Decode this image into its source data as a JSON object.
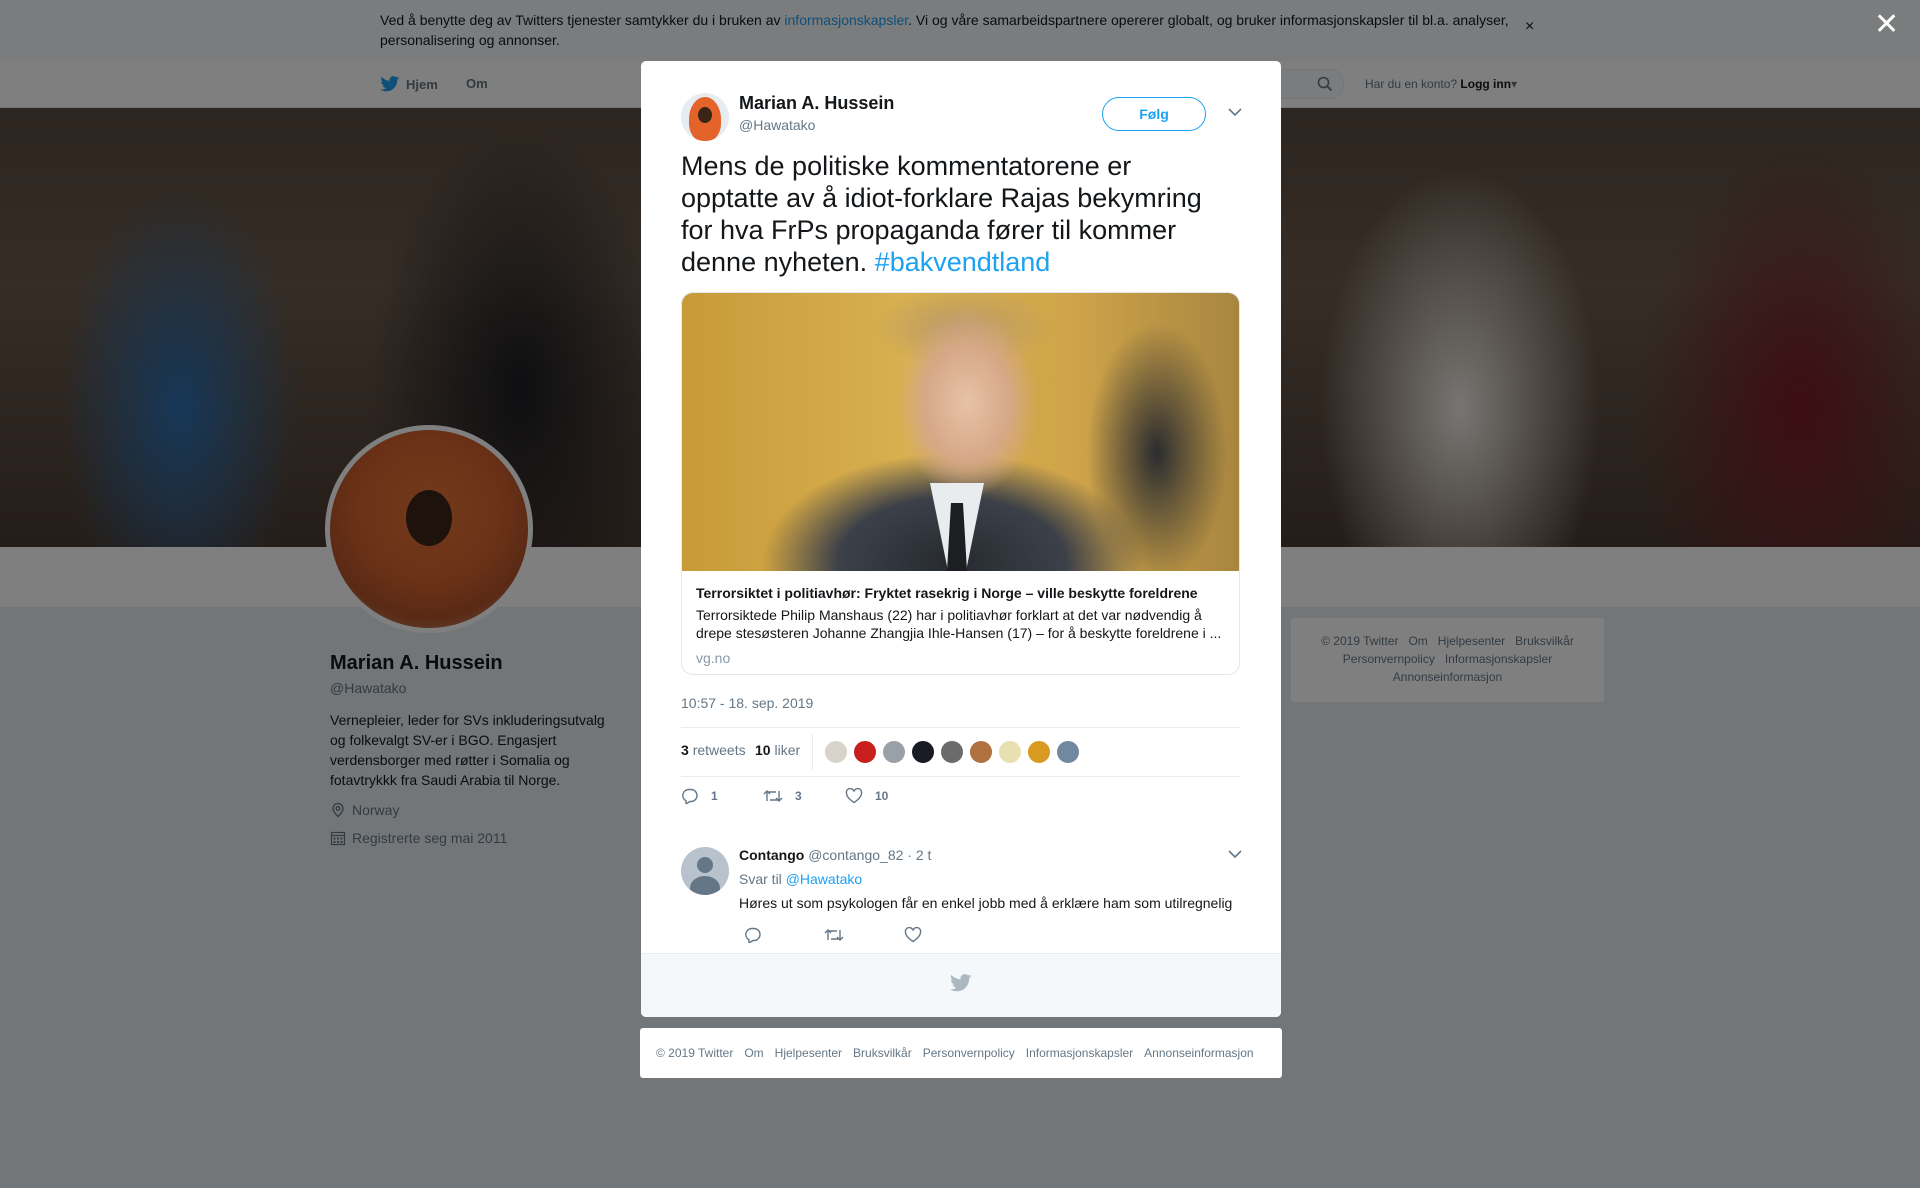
{
  "cookie_notice": {
    "text_before": "Ved å benytte deg av Twitters tjenester samtykker du i bruken av ",
    "link": "informasjonskapsler",
    "text_after": ". Vi og våre samarbeidspartnere opererer globalt, og bruker informasjonskapsler til bl.a. analyser, personalisering og annonser.",
    "close": "×"
  },
  "nav": {
    "home": "Hjem",
    "about": "Om",
    "account_prompt": "Har du en konto?",
    "login": "Logg inn"
  },
  "profile": {
    "name": "Marian A. Hussein",
    "handle": "@Hawatako",
    "bio": "Vernepleier, leder for SVs inkluderingsutvalg og folkevalgt SV-er i BGO. Engasjert verdensborger med røtter i Somalia og fotavtrykkk fra Saudi Arabia til Norge.",
    "location": "Norway",
    "joined": "Registrerte seg mai 2011"
  },
  "side_footer": {
    "links": [
      "© 2019 Twitter",
      "Om",
      "Hjelpesenter",
      "Bruksvilkår",
      "Personvernpolicy",
      "Informasjonskapsler",
      "Annonseinformasjon"
    ]
  },
  "overlay_close": "✕",
  "tweet": {
    "author_name": "Marian A. Hussein",
    "author_handle": "@Hawatako",
    "follow_label": "Følg",
    "text": "Mens de politiske kommentatorene er opptatte av å idiot-forklare Rajas bekymring for hva FrPs propaganda fører til kommer denne nyheten. ",
    "hashtag": "#bakvendtland",
    "card": {
      "title": "Terrorsiktet i politiavhør: Fryktet rasekrig i Norge – ville beskytte foreldrene",
      "description": "Terrorsiktede Philip Manshaus (22) har i politiavhør forklart at det var nødvendig å drepe stesøsteren Johanne Zhangjia Ihle-Hansen (17) – for å beskytte foreldrene i ...",
      "domain": "vg.no"
    },
    "timestamp": "10:57 - 18. sep. 2019",
    "retweets": "3",
    "retweets_label": "retweets",
    "likes": "10",
    "likes_label": "liker",
    "liker_colors": [
      "#d8d4cc",
      "#c81e1e",
      "#9aa0a8",
      "#1a1a24",
      "#6a6a6a",
      "#b07040",
      "#e8e0b0",
      "#d89a20",
      "#7088a0"
    ],
    "action_counts": {
      "reply": "1",
      "retweet": "3",
      "like": "10"
    }
  },
  "reply": {
    "name": "Contango",
    "handle": "@contango_82",
    "age": "· 2 t",
    "reply_to_label": "Svar til",
    "reply_to_handle": "@Hawatako",
    "text": "Høres ut som psykologen får en enkel jobb med å erklære ham som utilregnelig"
  },
  "bottom_footer": {
    "links": [
      "© 2019 Twitter",
      "Om",
      "Hjelpesenter",
      "Bruksvilkår",
      "Personvernpolicy",
      "Informasjonskapsler",
      "Annonseinformasjon"
    ]
  },
  "colors": {
    "accent": "#1da1f2",
    "text": "#14171a",
    "muted": "#657786"
  }
}
